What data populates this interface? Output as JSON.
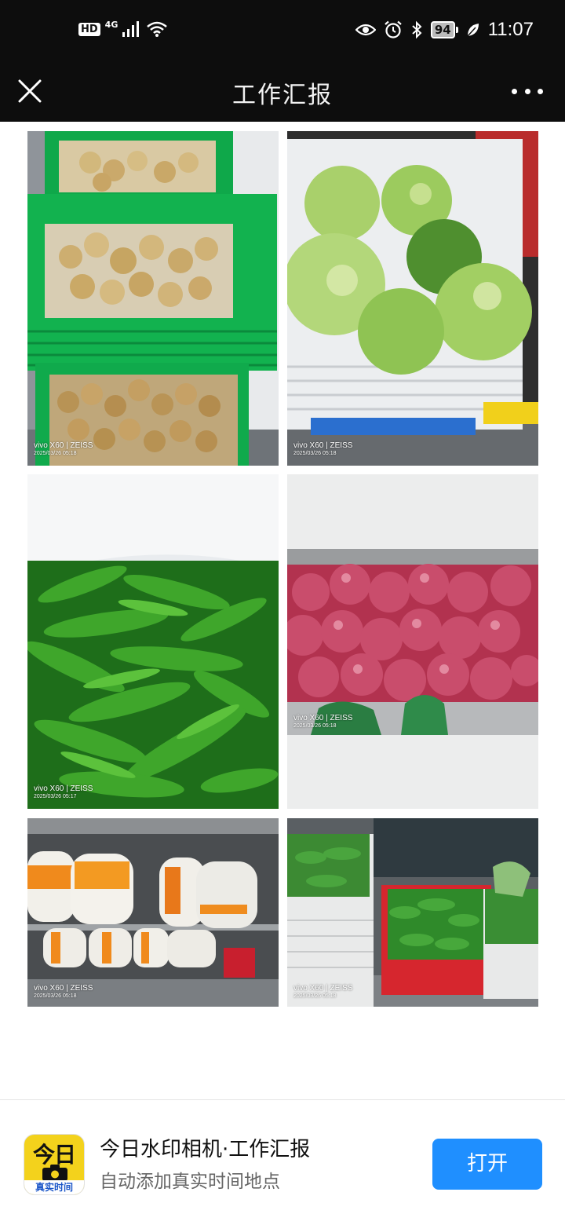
{
  "status_bar": {
    "hd_label": "HD",
    "network_type": "4G",
    "battery_level": "94",
    "time": "11:07",
    "icons": [
      "signal-icon",
      "wifi-icon",
      "eye-icon",
      "alarm-icon",
      "bluetooth-icon",
      "battery-icon",
      "leaf-icon"
    ]
  },
  "header": {
    "title": "工作汇报",
    "close_icon": "close-icon",
    "more_icon": "more-icon"
  },
  "photos": [
    {
      "subject": "potatoes in green crates",
      "brand": "vivo X60 | ZEISS",
      "date": "2025/03/26 05:18"
    },
    {
      "subject": "cabbages in white crate",
      "brand": "vivo X60 | ZEISS",
      "date": "2025/03/26 05:18"
    },
    {
      "subject": "green peppers",
      "brand": "vivo X60 | ZEISS",
      "date": "2025/03/26 05:17"
    },
    {
      "subject": "red onions in net bag",
      "brand": "vivo X60 | ZEISS",
      "date": "2025/03/26 05:18"
    },
    {
      "subject": "bagged radishes on shelf",
      "brand": "vivo X60 | ZEISS",
      "date": "2025/03/26 05:18"
    },
    {
      "subject": "leafy greens in baskets",
      "brand": "vivo X60 | ZEISS",
      "date": "2025/03/26 05:18"
    }
  ],
  "app_banner": {
    "icon_top_text": "今日",
    "icon_bottom_text": "真实时间",
    "app_name": "今日水印相机·工作汇报",
    "description": "自动添加真实时间地点",
    "open_label": "打开"
  },
  "colors": {
    "header_bg": "#0d0d0d",
    "button_blue": "#1f8fff",
    "icon_yellow": "#f3d21c"
  }
}
